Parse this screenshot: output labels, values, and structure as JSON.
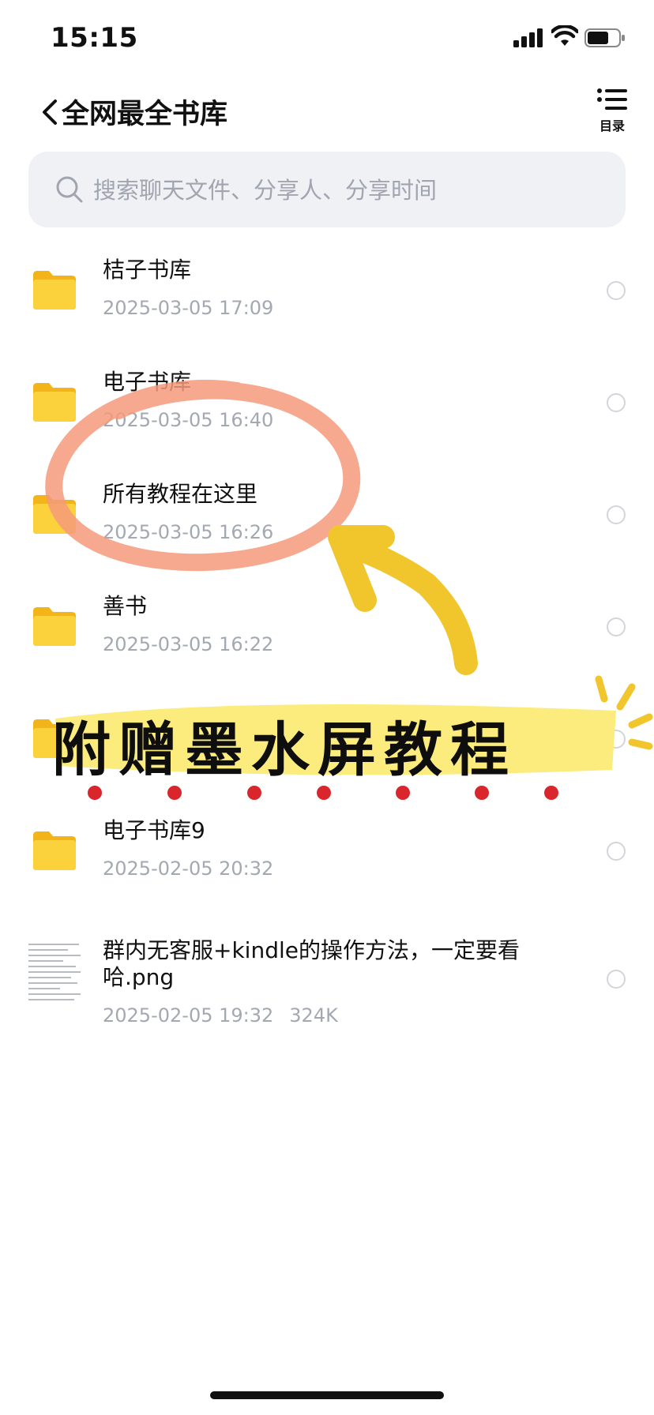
{
  "status_bar": {
    "time": "15:15"
  },
  "nav": {
    "title": "全网最全书库",
    "menu_label": "目录"
  },
  "search": {
    "placeholder": "搜索聊天文件、分享人、分享时间"
  },
  "files": [
    {
      "name": "桔子书库",
      "date": "2025-03-05 17:09"
    },
    {
      "name": "电子书库",
      "date": "2025-03-05 16:40"
    },
    {
      "name": "所有教程在这里",
      "date": "2025-03-05 16:26"
    },
    {
      "name": "善书",
      "date": "2025-03-05 16:22"
    },
    {
      "name": "电子书库9",
      "date": "2025-02-05 20:32"
    },
    {
      "name": "群内无客服+kindle的操作方法，一定要看",
      "name_line2": "哈.png",
      "date": "2025-02-05 19:32",
      "size": "324K"
    }
  ],
  "promo": {
    "text": "附赠墨水屏教程"
  },
  "colors": {
    "folder": "#f8c72a",
    "circle_mark": "#f49a7a",
    "arrow": "#f1c62c",
    "highlight": "#fbec7d",
    "dots": "#d9262c"
  }
}
